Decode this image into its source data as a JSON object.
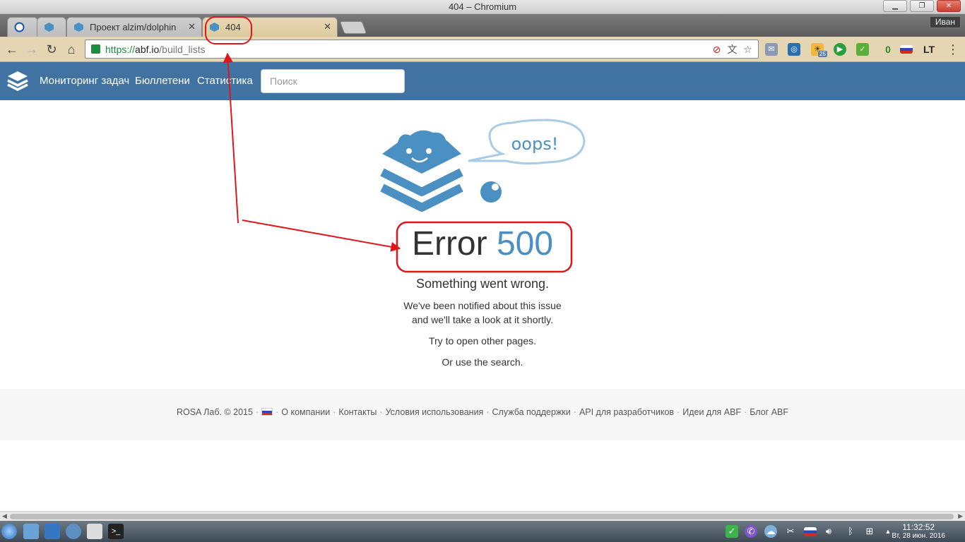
{
  "window": {
    "title": "404 – Chromium",
    "user": "Иван"
  },
  "tabs": [
    {
      "label": ""
    },
    {
      "label": ""
    },
    {
      "label": "Проект alzim/dolphin"
    },
    {
      "label": "404"
    }
  ],
  "toolbar": {
    "url_scheme": "https://",
    "url_host": "abf.io",
    "url_path": "/build_lists",
    "ext_badge_count": "0",
    "ext_weather_temp": "25"
  },
  "navbar": {
    "links": [
      "Мониторинг задач",
      "Бюллетени",
      "Статистика"
    ],
    "search_placeholder": "Поиск"
  },
  "error": {
    "bubble_text": "oops!",
    "title_word": "Error",
    "code": "500",
    "subtitle": "Something went wrong.",
    "line1": "We've been notified about this issue",
    "line2": "and we'll take a look at it shortly.",
    "line3": "Try to open other pages.",
    "line4": "Or use the search."
  },
  "footer": {
    "copyright": "ROSA Лаб. © 2015",
    "links": [
      "О компании",
      "Контакты",
      "Условия использования",
      "Служба поддержки",
      "API для разработчиков",
      "Идеи для ABF",
      "Блог ABF"
    ]
  },
  "taskbar": {
    "time": "11:32:52",
    "date": "Вт, 28 июн. 2016"
  },
  "colors": {
    "navbar": "#4073a1",
    "accent": "#4a90c2",
    "annotation": "#e0161b"
  }
}
